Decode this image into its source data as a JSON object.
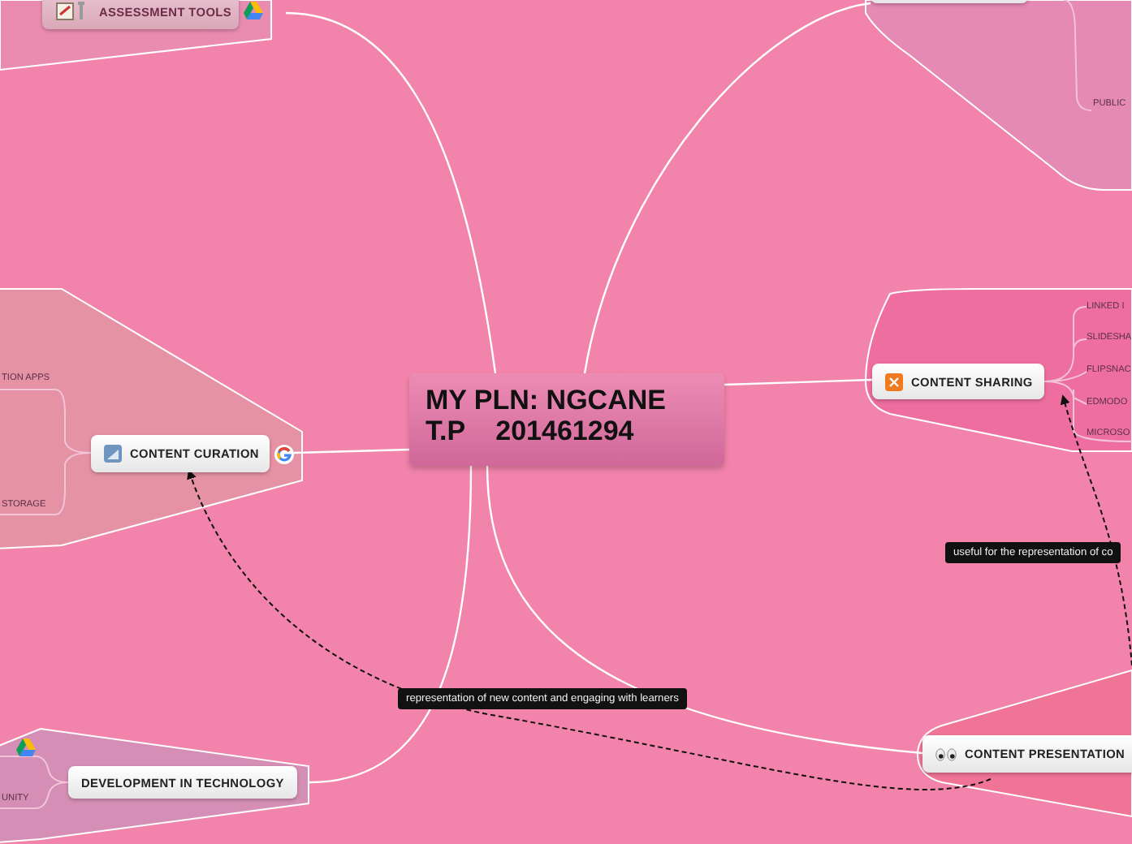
{
  "central_topic": {
    "lines": [
      "MY PLN: NGCANE",
      "T.P    201461294"
    ]
  },
  "branches": [
    {
      "label": "ASSESSMENT TOOLS"
    },
    {
      "subtopics": [
        "PUBLIC"
      ]
    },
    {
      "label": "CONTENT CURATION",
      "subtopics": [
        "TION APPS",
        "STORAGE"
      ]
    },
    {
      "label": "CONTENT SHARING",
      "subtopics": [
        "LINKED I",
        "SLIDESHA",
        "FLIPSNAC",
        "EDMODO",
        "MICROSO"
      ]
    },
    {
      "label": "CONTENT PRESENTATION"
    },
    {
      "label": "DEVELOPMENT IN TECHNOLOGY",
      "subtopics": [
        "UNITY"
      ]
    }
  ],
  "notes": [
    {
      "text": "useful for the representation of co"
    },
    {
      "text": "representation of new content and engaging with learners"
    }
  ]
}
